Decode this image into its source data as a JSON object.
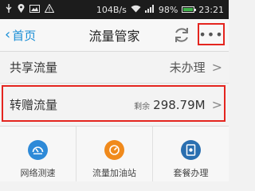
{
  "status_bar": {
    "speed": "104B/s",
    "battery": "98%",
    "time": "23:21"
  },
  "nav": {
    "back_label": "首页",
    "title": "流量管家",
    "more_label": "•••"
  },
  "rows": [
    {
      "label": "共享流量",
      "status": "未办理"
    },
    {
      "label": "转赠流量",
      "remain_label": "剩余",
      "remain_value": "298.79M"
    }
  ],
  "tiles": [
    {
      "label": "网络测速",
      "icon": "speed-test-icon",
      "color": "#2e8ad8"
    },
    {
      "label": "流量加油站",
      "icon": "gauge-icon",
      "color": "#f08a1c"
    },
    {
      "label": "套餐办理",
      "icon": "plan-icon",
      "color": "#2a6fb0"
    }
  ],
  "colors": {
    "accent": "#1a8ed6",
    "highlight": "#e4251f",
    "battery": "#3fb24a"
  }
}
